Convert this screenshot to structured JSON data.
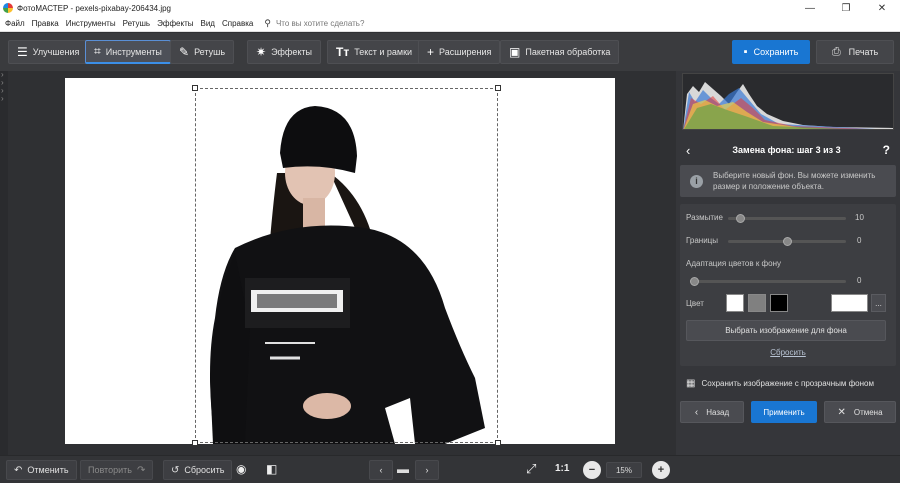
{
  "window": {
    "title": "ФотоМАСТЕР - pexels-pixabay-206434.jpg",
    "controls": [
      "—",
      "❐",
      "✕"
    ]
  },
  "menu": {
    "items": [
      "Файл",
      "Правка",
      "Инструменты",
      "Ретушь",
      "Эффекты",
      "Вид",
      "Справка"
    ],
    "search_placeholder": "Что вы хотите сделать?"
  },
  "toolbar": {
    "tabs": [
      {
        "label": "Улучшения",
        "icon": "sliders-icon"
      },
      {
        "label": "Инструменты",
        "icon": "crop-icon"
      },
      {
        "label": "Ретушь",
        "icon": "brush-icon"
      },
      {
        "label": "Эффекты",
        "icon": "sparkle-icon"
      },
      {
        "label": "Текст и рамки",
        "icon": "text-icon"
      },
      {
        "label": "Расширения",
        "icon": "plus-icon"
      },
      {
        "label": "Пакетная обработка",
        "icon": "batch-icon"
      }
    ],
    "active_tab": "Инструменты",
    "save_label": "Сохранить",
    "print_label": "Печать"
  },
  "panel": {
    "step_title": "Замена фона: шаг 3 из 3",
    "help": "?",
    "info_text_1": "Выберите новый фон. Вы можете изменить",
    "info_text_2": "размер и положение объекта.",
    "blur": {
      "label": "Размытие",
      "value": "10",
      "level": 0.1
    },
    "borders": {
      "label": "Границы",
      "value": "0",
      "level": 0.5
    },
    "adapt": {
      "label": "Адаптация цветов к фону",
      "value": "0",
      "level": 0.0
    },
    "color_label": "Цвет",
    "swatches": [
      "#ffffff",
      "#808080",
      "#000000"
    ],
    "custom_color": "#ffffff",
    "more_label": "...",
    "choose_image_label": "Выбрать изображение для фона",
    "reset_label": "Сбросить",
    "save_transparent_label": "Сохранить изображение с прозрачным фоном",
    "back_label": "Назад",
    "apply_label": "Применить",
    "cancel_label": "Отмена"
  },
  "bottom": {
    "undo_label": "Отменить",
    "redo_label": "Повторить",
    "reset_label": "Сбросить",
    "ratio_label": "1:1",
    "zoom": "15%"
  },
  "colors": {
    "accent": "#1976d2",
    "panel_bg": "#35363a",
    "workspace_bg": "#2f3033"
  }
}
